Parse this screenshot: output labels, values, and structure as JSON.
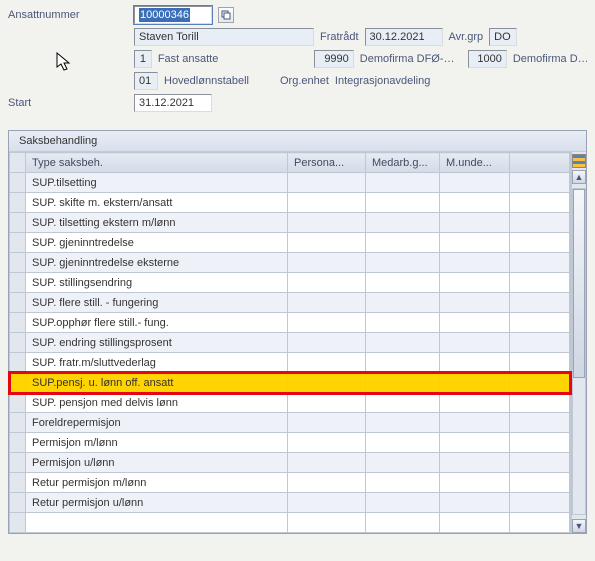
{
  "header": {
    "ansattnummer_label": "Ansattnummer",
    "ansattnummer_value": "10000346",
    "name": "Staven Torill",
    "fratradt_label": "Fratrådt",
    "fratradt_value": "30.12.2021",
    "avrgrp_label": "Avr.grp",
    "avrgrp_value": "DO",
    "code1": "1",
    "code1_text": "Fast ansatte",
    "code2": "9990",
    "code2_text": "Demofirma DFØ-…",
    "code3": "1000",
    "code3_text": "Demofirma D…",
    "tab_code": "01",
    "tab_text": "Hovedlønnstabell",
    "orgenhet_label": "Org.enhet",
    "orgenhet_value": "Integrasjonavdeling",
    "start_label": "Start",
    "start_value": "31.12.2021"
  },
  "panel": {
    "title": "Saksbehandling",
    "columns": [
      "",
      "Type saksbeh.",
      "Persona...",
      "Medarb.g...",
      "M.unde...",
      ""
    ],
    "rows": [
      {
        "t": "SUP.tilsetting"
      },
      {
        "t": "SUP. skifte m. ekstern/ansatt"
      },
      {
        "t": "SUP. tilsetting ekstern m/lønn"
      },
      {
        "t": "SUP. gjeninntredelse"
      },
      {
        "t": "SUP. gjeninntredelse eksterne"
      },
      {
        "t": "SUP. stillingsendring"
      },
      {
        "t": "SUP. flere still. - fungering"
      },
      {
        "t": "SUP.opphør flere still.- fung."
      },
      {
        "t": "SUP. endring stillingsprosent"
      },
      {
        "t": "SUP. fratr.m/sluttvederlag"
      },
      {
        "t": "SUP.pensj. u. lønn off. ansatt",
        "hl": true
      },
      {
        "t": "SUP. pensjon med delvis lønn"
      },
      {
        "t": "Foreldrepermisjon"
      },
      {
        "t": "Permisjon m/lønn"
      },
      {
        "t": "Permisjon u/lønn"
      },
      {
        "t": "Retur permisjon m/lønn"
      },
      {
        "t": "Retur permisjon u/lønn"
      },
      {
        "t": ""
      }
    ]
  }
}
